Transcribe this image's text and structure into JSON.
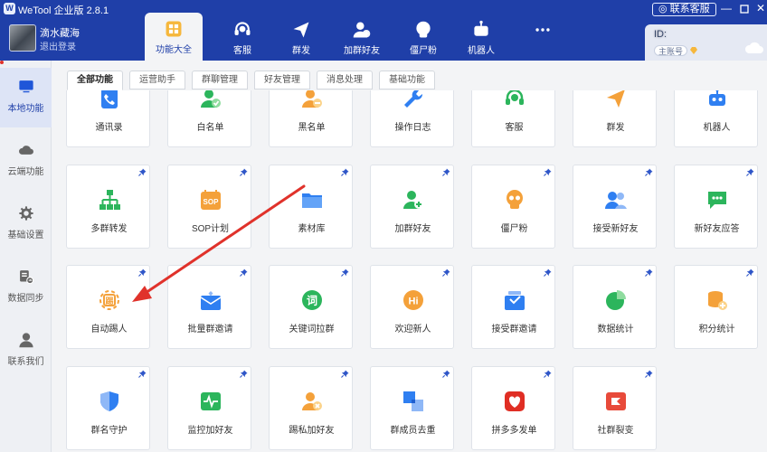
{
  "app": {
    "title": "WeTool 企业版 2.8.1",
    "support_button": "联系客服",
    "icon_glyph": "W"
  },
  "user": {
    "name": "滴水藏海",
    "logout": "退出登录"
  },
  "nav": [
    {
      "label": "功能大全",
      "icon": "grid-icon",
      "active": true
    },
    {
      "label": "客服",
      "icon": "headset-icon"
    },
    {
      "label": "群发",
      "icon": "send-icon"
    },
    {
      "label": "加群好友",
      "icon": "add-friend-icon"
    },
    {
      "label": "僵尸粉",
      "icon": "skull-icon"
    },
    {
      "label": "机器人",
      "icon": "robot-icon"
    },
    {
      "label": "",
      "icon": "more-icon"
    }
  ],
  "account": {
    "id_label": "ID:",
    "main_badge": "主账号"
  },
  "sidebar": [
    {
      "label": "本地功能",
      "icon": "monitor-icon",
      "active": true
    },
    {
      "label": "云端功能",
      "icon": "cloud-icon"
    },
    {
      "label": "基础设置",
      "icon": "gear-icon"
    },
    {
      "label": "数据同步",
      "icon": "sync-icon"
    },
    {
      "label": "联系我们",
      "icon": "person-icon"
    }
  ],
  "tabs": [
    "全部功能",
    "运营助手",
    "群聊管理",
    "好友管理",
    "消息处理",
    "基础功能"
  ],
  "features": [
    [
      {
        "label": "通讯录",
        "icon": "contacts-icon",
        "color": "#2f7ff1"
      },
      {
        "label": "白名单",
        "icon": "whitelist-icon",
        "color": "#2cb55c"
      },
      {
        "label": "黑名单",
        "icon": "blacklist-icon",
        "color": "#f4a13a"
      },
      {
        "label": "操作日志",
        "icon": "wrench-icon",
        "color": "#2f7ff1"
      },
      {
        "label": "客服",
        "icon": "headset-icon",
        "color": "#2cb55c"
      },
      {
        "label": "群发",
        "icon": "send-icon",
        "color": "#f4a13a"
      },
      {
        "label": "机器人",
        "icon": "robot-icon",
        "color": "#2f7ff1"
      }
    ],
    [
      {
        "label": "多群转发",
        "icon": "forward-icon",
        "color": "#2cb55c"
      },
      {
        "label": "SOP计划",
        "icon": "sop-icon",
        "color": "#f4a13a"
      },
      {
        "label": "素材库",
        "icon": "folder-icon",
        "color": "#2f7ff1"
      },
      {
        "label": "加群好友",
        "icon": "add-friend-icon",
        "color": "#2cb55c"
      },
      {
        "label": "僵尸粉",
        "icon": "skull-icon",
        "color": "#f4a13a"
      },
      {
        "label": "接受新好友",
        "icon": "accept-friend-icon",
        "color": "#2f7ff1"
      },
      {
        "label": "新好友应答",
        "icon": "reply-icon",
        "color": "#2cb55c"
      }
    ],
    [
      {
        "label": "自动踢人",
        "icon": "kick-icon",
        "color": "#f4a13a"
      },
      {
        "label": "批量群邀请",
        "icon": "invite-icon",
        "color": "#2f7ff1"
      },
      {
        "label": "关键词拉群",
        "icon": "keyword-icon",
        "color": "#2cb55c"
      },
      {
        "label": "欢迎新人",
        "icon": "welcome-icon",
        "color": "#f4a13a"
      },
      {
        "label": "接受群邀请",
        "icon": "accept-invite-icon",
        "color": "#2f7ff1"
      },
      {
        "label": "数据统计",
        "icon": "pie-chart-icon",
        "color": "#2cb55c"
      },
      {
        "label": "积分统计",
        "icon": "points-icon",
        "color": "#f4a13a"
      }
    ],
    [
      {
        "label": "群名守护",
        "icon": "shield-icon",
        "color": "#2f7ff1"
      },
      {
        "label": "监控加好友",
        "icon": "monitor-wave-icon",
        "color": "#2cb55c"
      },
      {
        "label": "踢私加好友",
        "icon": "kick-friend-icon",
        "color": "#f4a13a"
      },
      {
        "label": "群成员去重",
        "icon": "dedupe-icon",
        "color": "#2f7ff1"
      },
      {
        "label": "拼多多发单",
        "icon": "pdd-icon",
        "color": "#e02e24"
      },
      {
        "label": "社群裂变",
        "icon": "fission-icon",
        "color": "#e84a3a"
      }
    ]
  ],
  "colors": {
    "header": "#1f3fa8",
    "pin": "#2f56c8",
    "arrow": "#e0322b"
  }
}
